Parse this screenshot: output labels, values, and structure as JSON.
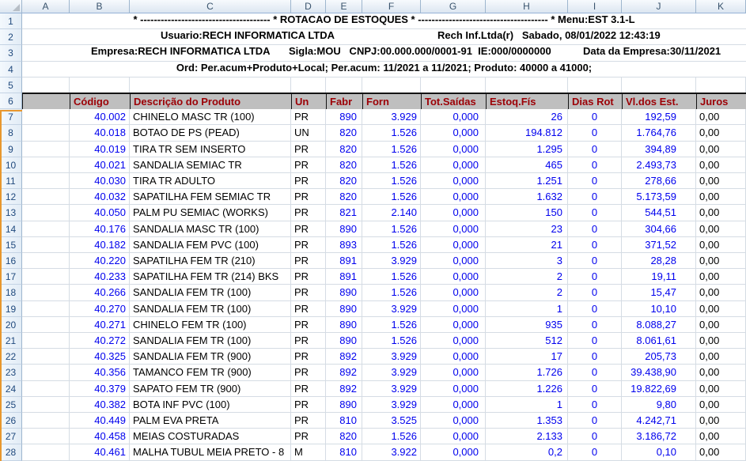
{
  "sheet": {
    "columns": [
      "A",
      "B",
      "C",
      "D",
      "E",
      "F",
      "G",
      "H",
      "I",
      "J",
      "K"
    ],
    "row_numbers": [
      1,
      2,
      3,
      4,
      5,
      6,
      7,
      8,
      9,
      10,
      11,
      12,
      13,
      14,
      15,
      16,
      17,
      18,
      19,
      20,
      21,
      22,
      23,
      24,
      25,
      26,
      27,
      28
    ]
  },
  "report": {
    "title_line": "* -------------------------------------- * ROTACAO DE ESTOQUES * -------------------------------------- * Menu:EST 3.1-L",
    "usuario": "Usuario:RECH INFORMATICA LTDA",
    "empresa_direita": "Rech Inf.Ltda(r)   Sabado, 08/01/2022 12:43:19",
    "empresa": "Empresa:RECH INFORMATICA LTDA",
    "sigla_cnpj": "Sigla:MOU   CNPJ:00.000.000/0001-91  IE:000/0000000",
    "data_empresa": "Data da Empresa:30/11/2021",
    "ord_line": "Ord: Per.acum+Produto+Local; Per.acum: 11/2021 a 11/2021; Produto: 40000 a 41000;"
  },
  "table": {
    "headers": [
      "Código",
      "Descrição do Produto",
      "Un",
      "Fabr",
      "Forn",
      "Tot.Saídas",
      "Estoq.Fís",
      "Dias Rot",
      "Vl.dos Est.",
      "Juros"
    ],
    "rows": [
      [
        "40.002",
        "CHINELO MASC TR (100)",
        "PR",
        "890",
        "3.929",
        "0,000",
        "26",
        "0",
        "192,59",
        "0,00"
      ],
      [
        "40.018",
        "BOTAO DE PS (PEAD)",
        "UN",
        "820",
        "1.526",
        "0,000",
        "194.812",
        "0",
        "1.764,76",
        "0,00"
      ],
      [
        "40.019",
        "TIRA TR SEM INSERTO",
        "PR",
        "820",
        "1.526",
        "0,000",
        "1.295",
        "0",
        "394,89",
        "0,00"
      ],
      [
        "40.021",
        "SANDALIA SEMIAC TR",
        "PR",
        "820",
        "1.526",
        "0,000",
        "465",
        "0",
        "2.493,73",
        "0,00"
      ],
      [
        "40.030",
        "TIRA TR ADULTO",
        "PR",
        "820",
        "1.526",
        "0,000",
        "1.251",
        "0",
        "278,66",
        "0,00"
      ],
      [
        "40.032",
        "SAPATILHA FEM SEMIAC TR",
        "PR",
        "820",
        "1.526",
        "0,000",
        "1.632",
        "0",
        "5.173,59",
        "0,00"
      ],
      [
        "40.050",
        "PALM PU SEMIAC (WORKS)",
        "PR",
        "821",
        "2.140",
        "0,000",
        "150",
        "0",
        "544,51",
        "0,00"
      ],
      [
        "40.176",
        "SANDALIA MASC TR (100)",
        "PR",
        "890",
        "1.526",
        "0,000",
        "23",
        "0",
        "304,66",
        "0,00"
      ],
      [
        "40.182",
        "SANDALIA FEM PVC (100)",
        "PR",
        "893",
        "1.526",
        "0,000",
        "21",
        "0",
        "371,52",
        "0,00"
      ],
      [
        "40.220",
        "SAPATILHA FEM TR (210)",
        "PR",
        "891",
        "3.929",
        "0,000",
        "3",
        "0",
        "28,28",
        "0,00"
      ],
      [
        "40.233",
        "SAPATILHA FEM TR (214) BKS",
        "PR",
        "891",
        "1.526",
        "0,000",
        "2",
        "0",
        "19,11",
        "0,00"
      ],
      [
        "40.266",
        "SANDALIA FEM TR (100)",
        "PR",
        "890",
        "1.526",
        "0,000",
        "2",
        "0",
        "15,47",
        "0,00"
      ],
      [
        "40.270",
        "SANDALIA FEM TR (100)",
        "PR",
        "890",
        "3.929",
        "0,000",
        "1",
        "0",
        "10,10",
        "0,00"
      ],
      [
        "40.271",
        "CHINELO FEM TR (100)",
        "PR",
        "890",
        "1.526",
        "0,000",
        "935",
        "0",
        "8.088,27",
        "0,00"
      ],
      [
        "40.272",
        "SANDALIA FEM TR (100)",
        "PR",
        "890",
        "1.526",
        "0,000",
        "512",
        "0",
        "8.061,61",
        "0,00"
      ],
      [
        "40.325",
        "SANDALIA FEM TR (900)",
        "PR",
        "892",
        "3.929",
        "0,000",
        "17",
        "0",
        "205,73",
        "0,00"
      ],
      [
        "40.356",
        "TAMANCO FEM TR (900)",
        "PR",
        "892",
        "3.929",
        "0,000",
        "1.726",
        "0",
        "39.438,90",
        "0,00"
      ],
      [
        "40.379",
        "SAPATO FEM TR (900)",
        "PR",
        "892",
        "3.929",
        "0,000",
        "1.226",
        "0",
        "19.822,69",
        "0,00"
      ],
      [
        "40.382",
        "BOTA INF PVC (100)",
        "PR",
        "890",
        "3.929",
        "0,000",
        "1",
        "0",
        "9,80",
        "0,00"
      ],
      [
        "40.449",
        "PALM EVA PRETA",
        "PR",
        "810",
        "3.525",
        "0,000",
        "1.353",
        "0",
        "4.242,71",
        "0,00"
      ],
      [
        "40.458",
        "MEIAS COSTURADAS",
        "PR",
        "820",
        "1.526",
        "0,000",
        "2.133",
        "0",
        "3.186,72",
        "0,00"
      ],
      [
        "40.461",
        "MALHA TUBUL MEIA PRETO - 8",
        "M",
        "810",
        "3.922",
        "0,000",
        "0,2",
        "0",
        "0,10",
        "0,00"
      ]
    ]
  },
  "colors": {
    "table_header_fill": "#BFBFBF",
    "table_header_text": "#9C0006",
    "value_blue": "#0000EE",
    "text_black": "#000000",
    "freeze_line_orange": "#E8972E"
  }
}
